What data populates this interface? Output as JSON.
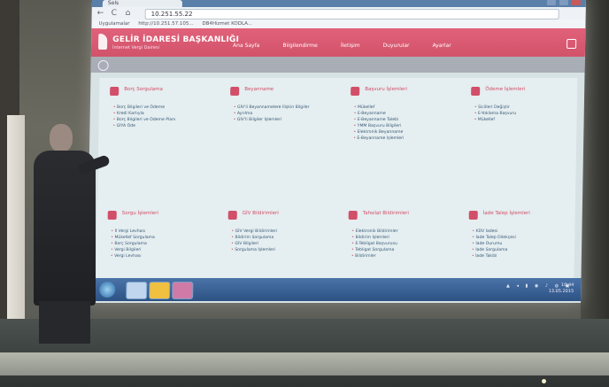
{
  "browser": {
    "tab_label": "Sels",
    "url": "10.251.55.22",
    "bookmarks": [
      "Uygulamalar",
      "http://10.251.57.105...",
      "DB4Hizmet KODLA..."
    ]
  },
  "app": {
    "title": "GELİR İDARESİ BAŞKANLIĞI",
    "subtitle": "İnternet Vergi Dairesi",
    "menu": [
      "Ana Sayfa",
      "Bilgilendirme",
      "İletişim",
      "Duyurular",
      "Ayarlar"
    ]
  },
  "categories": [
    {
      "title": "Borç Sorgulama",
      "color": "#d24f69",
      "items": [
        "Borç Bilgileri ve Ödeme",
        "Kredi Kartıyla",
        "Borç Bilgileri ve Ödeme Planı",
        "GİYA Öde"
      ]
    },
    {
      "title": "Beyanname",
      "color": "#d24f69",
      "items": [
        "GİV'li Beyannamelere İlişkin Bilgiler",
        "Ayrılma",
        "GİV'li Bilgiler İşlemleri"
      ]
    },
    {
      "title": "Başvuru İşlemleri",
      "color": "#d24f69",
      "items": [
        "Mükellef",
        "E-Beyanname",
        "E-Beyanname Talebi",
        "YMM Başvuru Bilgileri",
        "Elektronik Beyanname",
        "E-Beyanname İşlemleri"
      ]
    },
    {
      "title": "Ödeme İşlemleri",
      "color": "#d24f69",
      "items": [
        "Sicilleri Değiştir",
        "E-Yoklama Başvuru",
        "Mükellef"
      ]
    },
    {
      "title": "Sorgu İşlemleri",
      "color": "#d24f69",
      "items": [
        "İl Vergi Levhası",
        "Mükellef Sorgulama",
        "Borç Sorgulama",
        "Vergi Bilgileri",
        "Vergi Levhası"
      ]
    },
    {
      "title": "GİV Bildirimleri",
      "color": "#d24f69",
      "items": [
        "GİV Vergi Bildirimleri",
        "Bildirim Sorgulama",
        "GİV Bilgileri",
        "Sorgulama İşlemleri"
      ]
    },
    {
      "title": "Tahsilat Bildirimleri",
      "color": "#d24f69",
      "items": [
        "Elektronik Bildirimler",
        "Bildirim İşlemleri",
        "E-Tebligat Başvurusu",
        "Tebligat Sorgulama",
        "Bildirimler"
      ]
    },
    {
      "title": "İade Talep İşlemleri",
      "color": "#d24f69",
      "items": [
        "KDV İadesi",
        "İade Talep Dilekçesi",
        "İade Durumu",
        "İade Sorgulama",
        "İade Takibi"
      ]
    }
  ],
  "taskbar": {
    "clock_time": "10:44",
    "clock_date": "13.05.2015"
  }
}
